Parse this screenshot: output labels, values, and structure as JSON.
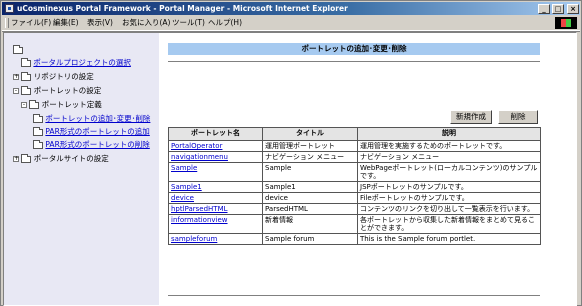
{
  "window": {
    "title": "uCosminexus Portal Framework - Portal Manager - Microsoft Internet Explorer"
  },
  "menubar": {
    "items": [
      "ファイル(F)",
      "編集(E)",
      "表示(V)",
      "お気に入り(A)",
      "ツール(T)",
      "ヘルプ(H)"
    ]
  },
  "sidebar": {
    "items": [
      {
        "label": "ポータルプロジェクトの選択",
        "link": true
      },
      {
        "label": "リポジトリの設定",
        "link": false
      },
      {
        "label": "ポートレットの設定",
        "link": false
      },
      {
        "label": "ポートレット定義",
        "link": false
      },
      {
        "label": "ポートレットの追加･変更･削除",
        "link": true
      },
      {
        "label": "PAR形式のポートレットの追加",
        "link": true
      },
      {
        "label": "PAR形式のポートレットの削除",
        "link": true
      },
      {
        "label": "ポータルサイトの設定",
        "link": false
      }
    ]
  },
  "main": {
    "header": "ポートレットの追加･変更･削除",
    "new_button": "新規作成",
    "delete_button": "削除",
    "table": {
      "headers": [
        "ポートレット名",
        "タイトル",
        "説明"
      ],
      "rows": [
        [
          "PortalOperator",
          "運用管理ポートレット",
          "運用管理を実施するためのポートレットです。"
        ],
        [
          "navigationmenu",
          "ナビゲーション メニュー",
          "ナビゲーション メニュー"
        ],
        [
          "Sample",
          "Sample",
          "WebPageポートレット(ローカルコンテンツ)のサンプルです。"
        ],
        [
          "Sample1",
          "Sample1",
          "JSPポートレットのサンプルです。"
        ],
        [
          "device",
          "device",
          "Fileポートレットのサンプルです。"
        ],
        [
          "hptlParsedHTML",
          "ParsedHTML",
          "コンテンツのリンクを切り出して一覧表示を行います。"
        ],
        [
          "informationview",
          "新着情報",
          "各ポートレットから収集した新着情報をまとめて見ることができます。"
        ],
        [
          "sampleforum",
          "Sample forum",
          "This is the Sample forum portlet."
        ]
      ]
    }
  },
  "colors": {
    "titlebar": "#0a246a",
    "header_bg": "#a6caf0",
    "sidebar_bg": "#e8e8f4",
    "link": "#0000cc"
  }
}
